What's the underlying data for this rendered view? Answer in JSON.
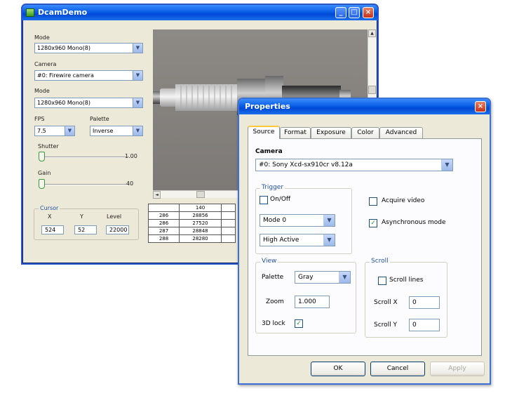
{
  "main_window": {
    "title": "DcamDemo",
    "mode1": {
      "label": "Mode",
      "value": "1280x960 Mono(8)"
    },
    "camera": {
      "label": "Camera",
      "value": "#0: Firewire camera"
    },
    "mode2": {
      "label": "Mode",
      "value": "1280x960 Mono(8)"
    },
    "fps": {
      "label": "FPS",
      "value": "7.5"
    },
    "palette": {
      "label": "Palette",
      "value": "Inverse"
    },
    "shutter": {
      "label": "Shutter",
      "value": "1.00",
      "level": 0.02
    },
    "gain": {
      "label": "Gain",
      "value": "40",
      "level": 0.02
    },
    "cursor": {
      "title": "Cursor",
      "x_label": "X",
      "y_label": "Y",
      "level_label": "Level",
      "x": "524",
      "y": "52",
      "level": "22000"
    },
    "table": {
      "header": "140",
      "rows": [
        {
          "label": "286",
          "value": "28856"
        },
        {
          "label": "286",
          "value": "27520"
        },
        {
          "label": "287",
          "value": "28848"
        },
        {
          "label": "288",
          "value": "28280"
        }
      ]
    }
  },
  "properties_dialog": {
    "title": "Properties",
    "tabs": [
      "Source",
      "Format",
      "Exposure",
      "Color",
      "Advanced"
    ],
    "active_tab": "Source",
    "camera": {
      "label": "Camera",
      "value": "#0: Sony Xcd-sx910cr v8.12a"
    },
    "trigger": {
      "title": "Trigger",
      "on_off_label": "On/Off",
      "on_off_checked": false,
      "mode": "Mode 0",
      "polarity": "High Active"
    },
    "acquire_video": {
      "label": "Acquire video",
      "checked": false
    },
    "async_mode": {
      "label": "Asynchronous mode",
      "checked": true
    },
    "view": {
      "title": "View",
      "palette_label": "Palette",
      "palette_value": "Gray",
      "zoom_label": "Zoom",
      "zoom_value": "1.000",
      "lock_3d_label": "3D lock",
      "lock_3d_checked": true
    },
    "scroll": {
      "title": "Scroll",
      "scroll_lines_label": "Scroll lines",
      "scroll_lines_checked": false,
      "scroll_x_label": "Scroll X",
      "scroll_x_value": "0",
      "scroll_y_label": "Scroll Y",
      "scroll_y_value": "0"
    },
    "buttons": {
      "ok": "OK",
      "cancel": "Cancel",
      "apply": "Apply"
    },
    "icons": {
      "close": "close-icon",
      "dropdown": "chevron-down-icon"
    }
  }
}
